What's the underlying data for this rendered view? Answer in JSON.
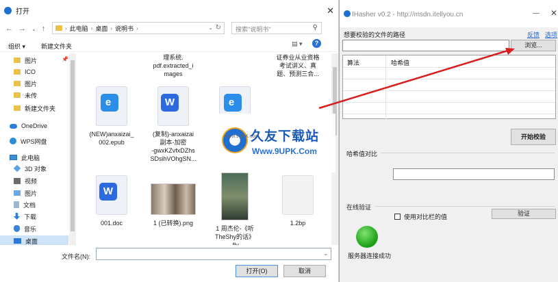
{
  "dialog": {
    "title": "打开",
    "breadcrumb": [
      "此电脑",
      "桌面",
      "说明书"
    ],
    "search_placeholder": "搜索\"说明书\"",
    "toolbar": {
      "organize": "组织 ▾",
      "new_folder": "新建文件夹"
    },
    "nav": [
      {
        "label": "图片",
        "icon": "folder-icon"
      },
      {
        "label": "ICO",
        "icon": "folder-icon"
      },
      {
        "label": "图片",
        "icon": "folder-icon"
      },
      {
        "label": "未传",
        "icon": "folder-icon"
      },
      {
        "label": "新建文件夹",
        "icon": "folder-icon"
      },
      {
        "label": "OneDrive",
        "icon": "cloud-icon"
      },
      {
        "label": "WPS网盘",
        "icon": "wps-icon"
      },
      {
        "label": "此电脑",
        "icon": "pc-icon"
      },
      {
        "label": "3D 对象",
        "icon": "3d-icon"
      },
      {
        "label": "视频",
        "icon": "video-icon"
      },
      {
        "label": "图片",
        "icon": "picture-icon"
      },
      {
        "label": "文档",
        "icon": "document-icon"
      },
      {
        "label": "下载",
        "icon": "download-icon"
      },
      {
        "label": "音乐",
        "icon": "music-icon"
      },
      {
        "label": "桌面",
        "icon": "desktop-icon"
      }
    ],
    "files": [
      {
        "name_lines": [
          "理系统.",
          "pdf.extracted_i",
          "mages"
        ],
        "kind": "text"
      },
      {
        "name_lines": [
          "证券业从业资格",
          "考试讲义、真",
          "题、预测三合..."
        ],
        "kind": "text"
      },
      {
        "name_lines": [
          "(NEW)anxaizai_",
          "002.epub"
        ],
        "kind": "epub"
      },
      {
        "name_lines": [
          "(复制)-anxaizai",
          "副本-加密",
          "-gwxKZvfxDZhs",
          "SDsihVOhgSN..."
        ],
        "kind": "doc"
      },
      {
        "name_lines": [],
        "kind": "epub"
      },
      {
        "name_lines": [
          "001.doc"
        ],
        "kind": "doc"
      },
      {
        "name_lines": [
          "1 (已转换).png"
        ],
        "kind": "png"
      },
      {
        "name_lines": [
          "1 周杰伦-《听",
          "TheShy的话》",
          ".flv"
        ],
        "kind": "flv"
      },
      {
        "name_lines": [
          "1.2bp"
        ],
        "kind": "blank"
      }
    ],
    "filename_label": "文件名(N):",
    "filename_value": "",
    "open_label": "打开(O)",
    "cancel_label": "取消"
  },
  "ihasher": {
    "title": "IHasher v0.2 - http://msdn.itellyou.cn",
    "file_label": "想要校验的文件的路径",
    "link1": "反馈",
    "link2": "选项",
    "path_value": "",
    "browse_label": "浏览...",
    "col_algo": "算法",
    "col_hash": "哈希值",
    "verify_label": "开始校验",
    "compare_label": "哈希值对比",
    "online_label": "在线验证",
    "use_compare_label": "使用对比栏的值",
    "verify2_label": "验证",
    "status": "服务器连接成功",
    "status_color": "#1fa21a"
  },
  "watermark": {
    "brand": "久友下载站",
    "url": "Www.9UPK.Com",
    "url_small": "www.9UPK.com"
  }
}
